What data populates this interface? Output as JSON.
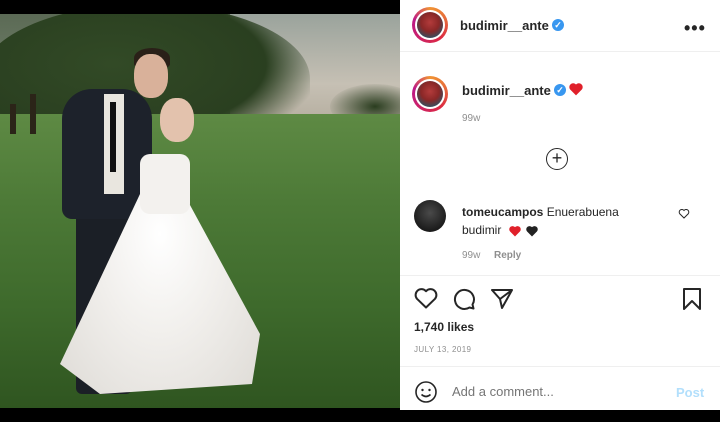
{
  "post": {
    "username": "budimir__ante",
    "verified_glyph": "✓",
    "more_label": "•••",
    "caption_timestamp": "99w",
    "comments": [
      {
        "username": "tomeucampos",
        "text_1": "Enuerabuena",
        "text_2": "budimir",
        "timestamp": "99w",
        "reply_label": "Reply"
      }
    ],
    "likes": "1,740 likes",
    "date": "JULY 13, 2019",
    "comment_placeholder": "Add a comment...",
    "post_label": "Post"
  },
  "icons": {
    "like": "heart-outline-icon",
    "comment": "speech-bubble-icon",
    "share": "paper-plane-icon",
    "save": "bookmark-icon",
    "add": "plus-circle-icon",
    "emoji": "smiley-icon"
  },
  "colors": {
    "accent": "#3897f0",
    "heart_red": "#ed4956",
    "post_disabled": "#b2dffc"
  }
}
